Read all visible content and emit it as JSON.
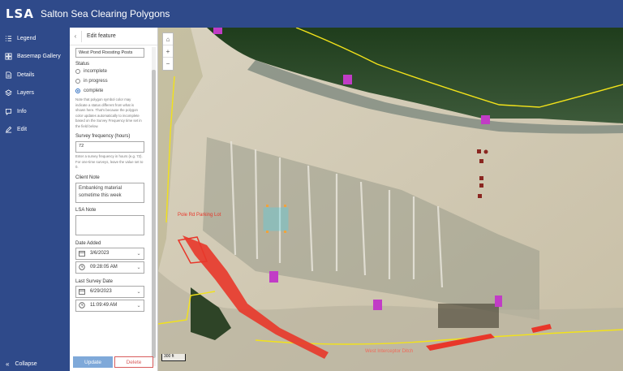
{
  "app": {
    "logo": "LSA",
    "title": "Salton Sea Clearing Polygons"
  },
  "sidebar": {
    "items": [
      {
        "label": "Legend",
        "icon": "legend-icon"
      },
      {
        "label": "Basemap Gallery",
        "icon": "basemap-icon"
      },
      {
        "label": "Details",
        "icon": "details-icon"
      },
      {
        "label": "Layers",
        "icon": "layers-icon"
      },
      {
        "label": "Info",
        "icon": "info-icon"
      },
      {
        "label": "Edit",
        "icon": "edit-icon"
      }
    ],
    "collapse_label": "Collapse"
  },
  "panel": {
    "title": "Edit feature",
    "feature_name": "West Pond Roosting Posts",
    "status_label": "Status",
    "status_options": [
      "incomplete",
      "in progress",
      "complete"
    ],
    "status_selected": "complete",
    "status_note": "Note that polygon symbol color may indicate a status different from what is shown here. That's because the polygon color updates automatically to incomplete based on the Survey Frequency time set in the field below.",
    "survey_freq_label": "Survey frequency (hours)",
    "survey_freq_value": "72",
    "survey_freq_note": "Enter a survey frequency in hours (e.g. 72). For one-time surveys, leave the value set to 0.",
    "client_note_label": "Client Note",
    "client_note_value": "Embanking material sometime this week",
    "lsa_note_label": "LSA Note",
    "lsa_note_value": "",
    "date_added_label": "Date Added",
    "date_added_date": "3/6/2023",
    "date_added_time": "09:28:05 AM",
    "last_survey_label": "Last Survey Date",
    "last_survey_date": "6/29/2023",
    "last_survey_time": "11:09:49 AM",
    "update_label": "Update",
    "delete_label": "Delete"
  },
  "map": {
    "labels": {
      "parking": "Pole Rd Parking Lot",
      "interceptor": "West Interceptor Ditch"
    },
    "scale_label": "300 ft",
    "colors": {
      "boundary": "#f2e21a",
      "site_marker": "#c13cc6",
      "clearing_red": "#e8372a",
      "selected": "#4fd3e8"
    }
  }
}
